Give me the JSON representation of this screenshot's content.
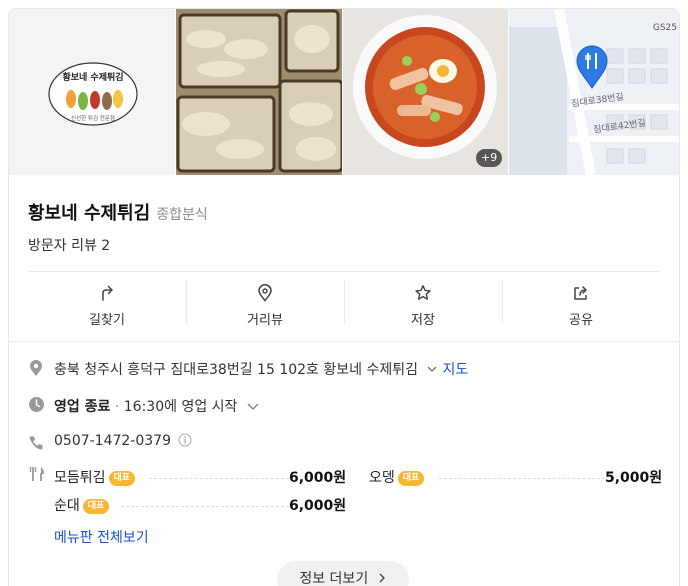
{
  "photos": {
    "logo_text_top": "황보네 수제튀김",
    "logo_text_bottom": "신선한 튀김 전문점",
    "more_count": "+9"
  },
  "map": {
    "labels": [
      "GS25",
      "짐대로38번길",
      "짐대로42번길"
    ]
  },
  "place": {
    "name": "황보네 수제튀김",
    "category": "종합분식",
    "reviews": "방문자 리뷰 2"
  },
  "actions": [
    {
      "label": "길찾기",
      "icon": "directions-icon"
    },
    {
      "label": "거리뷰",
      "icon": "location-pin-icon"
    },
    {
      "label": "저장",
      "icon": "star-icon"
    },
    {
      "label": "공유",
      "icon": "share-icon"
    }
  ],
  "details": {
    "address": "충북 청주시 흥덕구 짐대로38번길 15 102호 황보네 수제튀김",
    "map_link": "지도",
    "hours_status": "영업 종료",
    "hours_separator": "·",
    "hours_next": "16:30에 영업 시작",
    "phone": "0507-1472-0379"
  },
  "menu": {
    "badge": "대표",
    "items": [
      {
        "name": "모듬튀김",
        "price": "6,000원"
      },
      {
        "name": "오뎅",
        "price": "5,000원"
      },
      {
        "name": "순대",
        "price": "6,000원"
      }
    ],
    "view_all": "메뉴판 전체보기"
  },
  "more_info": "정보 더보기",
  "colors": {
    "link": "#1a4fd0",
    "badge": "#f7b733",
    "map_pin": "#2c7be5"
  }
}
